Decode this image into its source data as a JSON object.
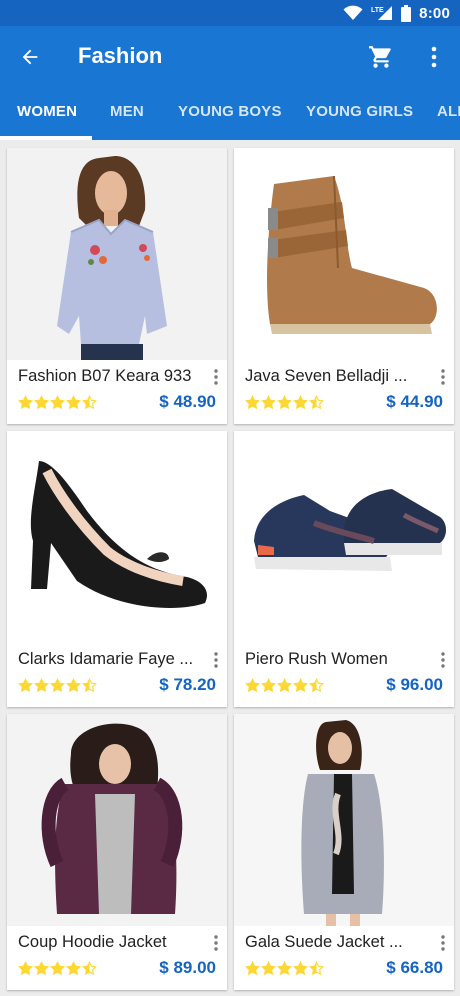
{
  "status": {
    "time": "8:00",
    "network": "LTE"
  },
  "appbar": {
    "title": "Fashion",
    "back_icon": "arrow-back-icon",
    "cart_icon": "shopping-cart-icon",
    "more_icon": "more-vert-icon"
  },
  "tabs": [
    {
      "label": "WOMEN",
      "active": true
    },
    {
      "label": "MEN",
      "active": false
    },
    {
      "label": "YOUNG BOYS",
      "active": false
    },
    {
      "label": "YOUNG GIRLS",
      "active": false
    },
    {
      "label": "ALL",
      "active": false
    }
  ],
  "colors": {
    "primary": "#1976d2",
    "primary_dark": "#1565c0",
    "price": "#1565c0",
    "star": "#fdd835"
  },
  "products": [
    {
      "name": "Fashion B07 Keara 933",
      "price": "$ 48.90",
      "rating": 4.5,
      "image": "woman-striped-shirt"
    },
    {
      "name": "Java Seven Belladji ...",
      "price": "$ 44.90",
      "rating": 4.5,
      "image": "brown-ankle-boot"
    },
    {
      "name": "Clarks Idamarie Faye ...",
      "price": "$ 78.20",
      "rating": 4.5,
      "image": "black-heel-pump"
    },
    {
      "name": "Piero Rush Women",
      "price": "$ 96.00",
      "rating": 4.5,
      "image": "navy-sneakers"
    },
    {
      "name": "Coup Hoodie Jacket",
      "price": "$ 89.00",
      "rating": 4.5,
      "image": "purple-hoodie"
    },
    {
      "name": "Gala Suede Jacket ...",
      "price": "$ 66.80",
      "rating": 4.5,
      "image": "grey-long-coat"
    }
  ]
}
